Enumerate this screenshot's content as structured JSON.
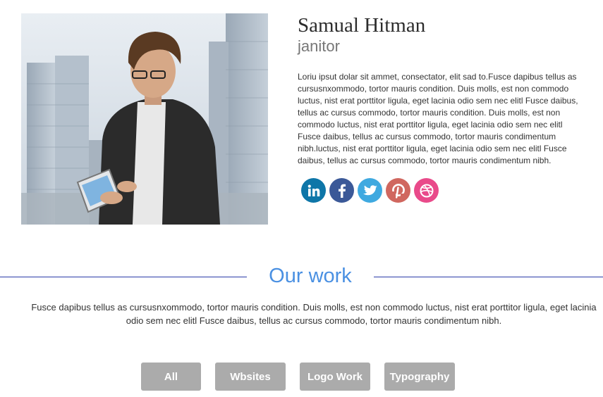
{
  "profile": {
    "name": "Samual Hitman",
    "role": "janitor",
    "bio": "Loriu ipsut dolar sit ammet, consectator, elit sad to.Fusce dapibus tellus as cursusnxommodo, tortor mauris condition. Duis molls, est non commodo luctus, nist erat porttitor ligula, eget lacinia odio sem nec elitl Fusce daibus, tellus ac cursus commodo, tortor mauris condition. Duis molls, est non commodo luctus, nist erat porttitor ligula, eget lacinia odio sem nec elitl Fusce daibus, tellus ac cursus commodo, tortor mauris condimentum nibh.luctus, nist erat porttitor ligula, eget lacinia odio sem nec elitl Fusce daibus, tellus ac cursus commodo, tortor mauris condimentum nibh."
  },
  "socials": [
    {
      "icon": "linkedin-icon",
      "color": "#0e76a8"
    },
    {
      "icon": "facebook-icon",
      "color": "#3b5998"
    },
    {
      "icon": "twitter-icon",
      "color": "#3fa9e0"
    },
    {
      "icon": "pinterest-icon",
      "color": "#d0675f"
    },
    {
      "icon": "dribbble-icon",
      "color": "#e94a8a"
    }
  ],
  "work": {
    "title": "Our work",
    "description": "Fusce dapibus tellus as cursusnxommodo, tortor mauris condition. Duis molls, est non commodo luctus, nist erat porttitor ligula, eget lacinia odio sem nec elitl Fusce daibus, tellus ac cursus commodo, tortor mauris condimentum nibh.",
    "filters": [
      "All",
      "Wbsites",
      "Logo Work",
      "Typography"
    ]
  },
  "colors": {
    "accent": "#4a90e2",
    "rule": "#2a3aa8",
    "filter_bg": "#ababab"
  }
}
